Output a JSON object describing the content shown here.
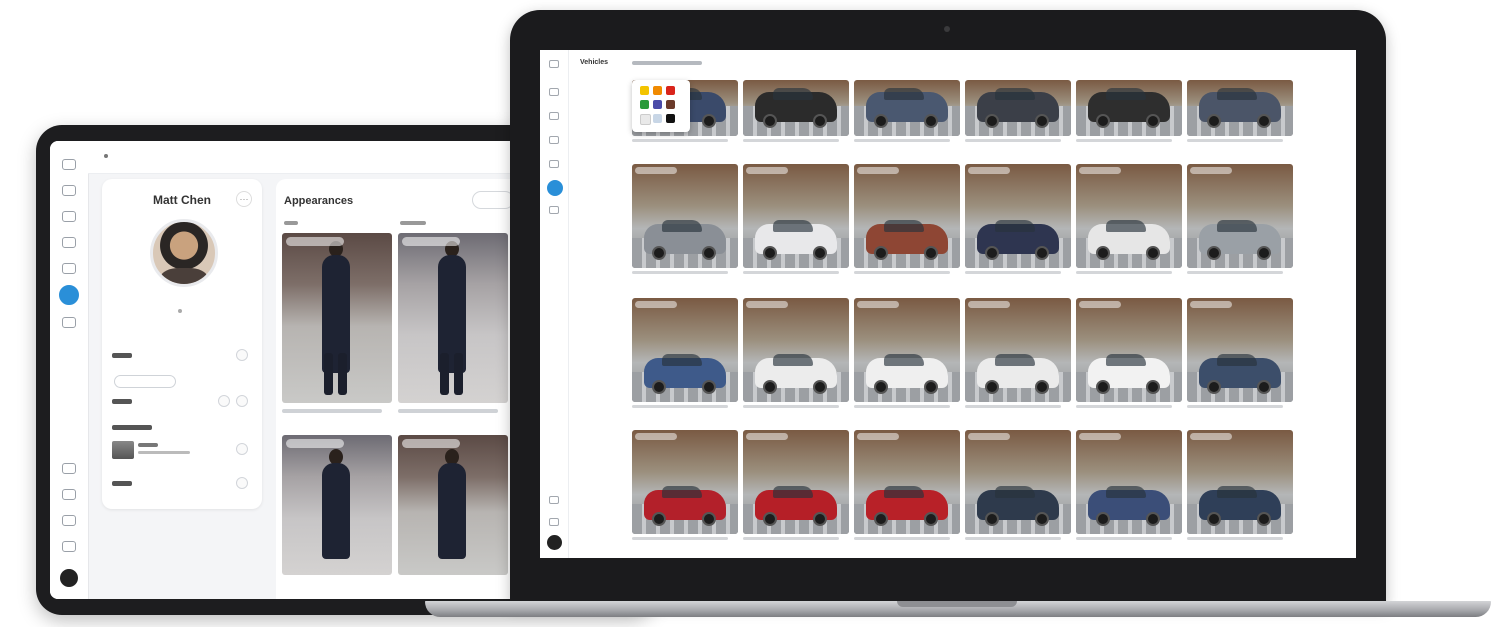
{
  "tablet": {
    "profile": {
      "name": "Matt Chen",
      "more_icon": "ellipsis-icon"
    },
    "panel": {
      "title": "Appearances",
      "search_icon": "search-icon"
    },
    "rail_icons": [
      "home-icon",
      "camera-icon",
      "video-icon",
      "calendar-icon",
      "grid-icon",
      "person-icon",
      "settings-icon",
      "bell-icon",
      "help-icon",
      "cloud-icon"
    ],
    "accent": "#2a8fd8"
  },
  "laptop": {
    "title": "Vehicles",
    "rail_icons": [
      "home-icon",
      "camera-icon",
      "video-icon",
      "grid-icon",
      "list-icon",
      "car-icon",
      "settings-icon",
      "bell-icon",
      "help-icon"
    ],
    "color_swatches": [
      "#f3c400",
      "#f08a00",
      "#d9241b",
      "#2a9a3a",
      "#4a4aa8",
      "#6b3a2a",
      "#e9e9e9",
      "#c8d6e6",
      "#111111"
    ],
    "vehicle_colors": [
      [
        "#3a4a6a",
        "#2b2b2b",
        "#4a5870",
        "#3b3f48",
        "#2e2e2e",
        "#4b5568"
      ],
      [
        "#8a8f96",
        "#e8e8ea",
        "#8e4634",
        "#2e3550",
        "#e6e6e6",
        "#9aa0a6"
      ],
      [
        "#3e5a8a",
        "#ececec",
        "#efefef",
        "#ebebeb",
        "#f2f2f2",
        "#3c4e6a"
      ],
      [
        "#b3202a",
        "#b51f27",
        "#b82128",
        "#2e3a4c",
        "#3b4e78",
        "#2f3f58"
      ]
    ]
  }
}
